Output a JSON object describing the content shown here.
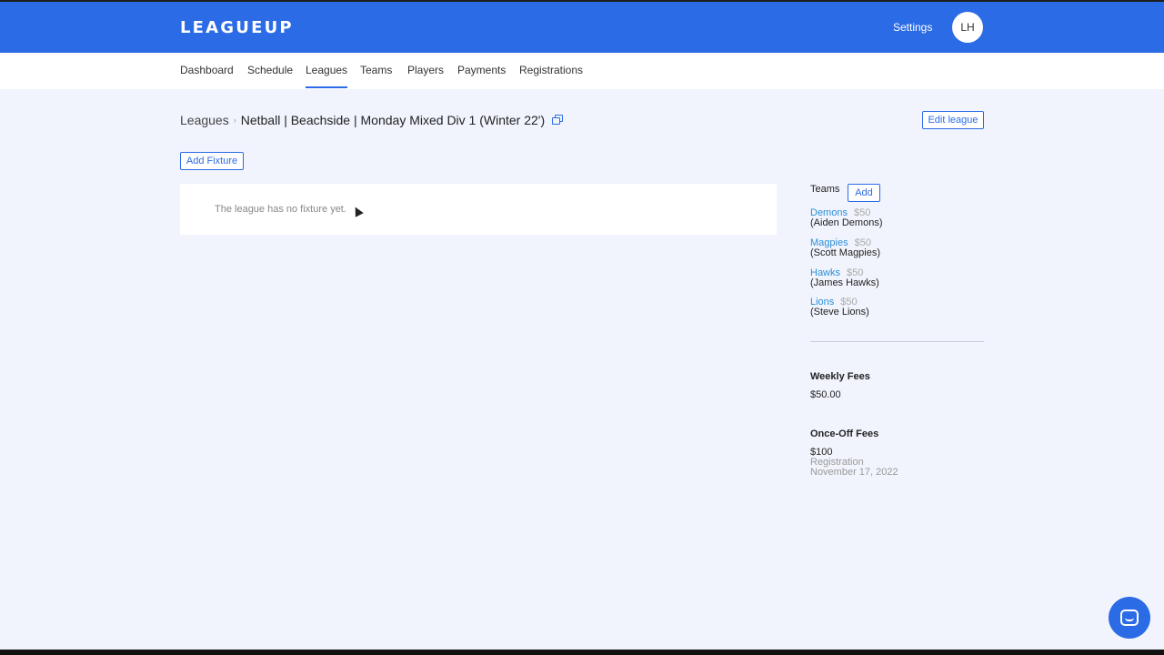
{
  "header": {
    "logo": "LEAGUEUP",
    "settings_label": "Settings",
    "avatar_initials": "LH",
    "accent_color": "#2c6be6"
  },
  "nav": {
    "items": [
      {
        "label": "Dashboard"
      },
      {
        "label": "Schedule"
      },
      {
        "label": "Leagues",
        "active": true
      },
      {
        "label": "Teams"
      },
      {
        "label": "Players"
      },
      {
        "label": "Payments"
      },
      {
        "label": "Registrations"
      }
    ]
  },
  "breadcrumb": {
    "root": "Leagues",
    "current": "Netball | Beachside | Monday Mixed Div 1 (Winter 22')",
    "copy_icon": "copy-icon"
  },
  "actions": {
    "edit_league": "Edit league",
    "add_fixture": "Add Fixture"
  },
  "fixture": {
    "empty_message": "The league has no fixture yet."
  },
  "sidebar": {
    "teams_heading": "Teams",
    "add_label": "Add",
    "teams": [
      {
        "name": "Demons",
        "fee": "$50",
        "owner": "(Aiden Demons)"
      },
      {
        "name": "Magpies",
        "fee": "$50",
        "owner": "(Scott Magpies)"
      },
      {
        "name": "Hawks",
        "fee": "$50",
        "owner": "(James Hawks)"
      },
      {
        "name": "Lions",
        "fee": "$50",
        "owner": "(Steve Lions)"
      }
    ],
    "weekly_fees_heading": "Weekly Fees",
    "weekly_fees_value": "$50.00",
    "once_off_heading": "Once-Off Fees",
    "once_off_amount": "$100",
    "once_off_type": "Registration",
    "once_off_date": "November 17, 2022"
  },
  "chat": {
    "icon": "chat-icon"
  }
}
